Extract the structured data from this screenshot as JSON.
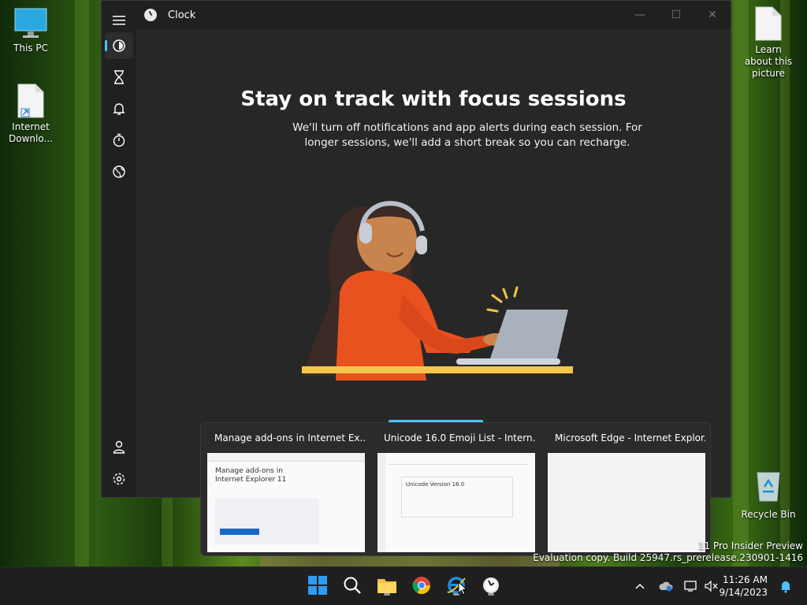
{
  "desktop": {
    "icons": [
      {
        "label": "This PC"
      },
      {
        "label": "Internet Downlo..."
      },
      {
        "label": "Learn about this picture"
      },
      {
        "label": "Recycle Bin"
      }
    ],
    "watermark": {
      "line1": "11 Pro Insider Preview",
      "line2": "Evaluation copy. Build 25947.rs_prerelease.230901-1416"
    }
  },
  "clock_window": {
    "title": "Clock",
    "controls": {
      "minimize": "—",
      "maximize": "☐",
      "close": "✕"
    },
    "nav": {
      "menu_icon": "hamburger-icon",
      "items": [
        "focus-sessions-icon",
        "timer-icon",
        "alarm-icon",
        "stopwatch-icon",
        "world-clock-icon"
      ],
      "bottom": [
        "account-icon",
        "settings-icon"
      ]
    },
    "headline": "Stay on track with focus sessions",
    "description": "We'll turn off notifications and app alerts during each session. For longer sessions, we'll add a short break so you can recharge."
  },
  "taskbar_preview": {
    "thumbs": [
      {
        "title": "Manage add-ons in Internet Ex...",
        "doc_heading": "Manage add-ons in Internet Explorer 11"
      },
      {
        "title": "Unicode 16.0 Emoji List - Intern...",
        "doc_heading": "Unicode Version 16.0"
      },
      {
        "title": "Microsoft Edge - Internet Explor..."
      }
    ]
  },
  "taskbar": {
    "apps": [
      "start-icon",
      "search-icon",
      "file-explorer-icon",
      "chrome-icon",
      "internet-explorer-icon",
      "clock-app-icon"
    ],
    "time": "11:26 AM",
    "date": "9/14/2023",
    "tray": [
      "chevron-up-icon",
      "onedrive-icon",
      "display-icon",
      "volume-muted-icon",
      "notifications-bell-icon"
    ]
  },
  "colors": {
    "accent": "#4cc2ff",
    "window_bg": "#202020",
    "content_bg": "#272727",
    "sweater": "#e8521e"
  }
}
